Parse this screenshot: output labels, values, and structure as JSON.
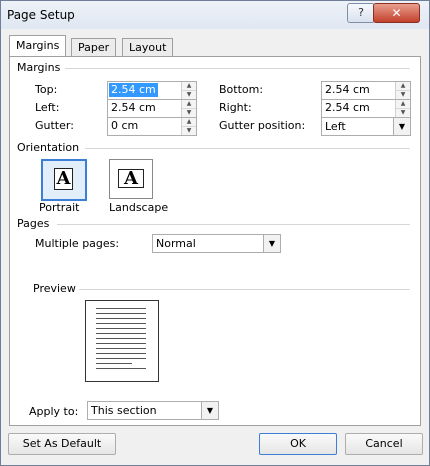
{
  "window": {
    "title": "Page Setup",
    "help_label": "?",
    "close_label": "✕"
  },
  "tabs": [
    {
      "label": "Margins"
    },
    {
      "label": "Paper"
    },
    {
      "label": "Layout"
    }
  ],
  "margins": {
    "section_label": "Margins",
    "top_label": "Top:",
    "top_value": "2.54 cm",
    "left_label": "Left:",
    "left_value": "2.54 cm",
    "gutter_label": "Gutter:",
    "gutter_value": "0 cm",
    "bottom_label": "Bottom:",
    "bottom_value": "2.54 cm",
    "right_label": "Right:",
    "right_value": "2.54 cm",
    "gutter_position_label": "Gutter position:",
    "gutter_position_value": "Left"
  },
  "orientation": {
    "section_label": "Orientation",
    "icon_letter": "A",
    "portrait_label": "Portrait",
    "landscape_label": "Landscape",
    "selected": "portrait"
  },
  "pages": {
    "section_label": "Pages",
    "multiple_pages_label": "Multiple pages:",
    "multiple_pages_value": "Normal"
  },
  "preview": {
    "section_label": "Preview"
  },
  "apply_to": {
    "label": "Apply to:",
    "value": "This section"
  },
  "buttons": {
    "set_default": "Set As Default",
    "ok": "OK",
    "cancel": "Cancel"
  },
  "colors": {
    "accent": "#3c7fd8",
    "selection": "#3399ff",
    "close": "#c2412c"
  },
  "icons": {
    "spin_up": "▲",
    "spin_down": "▼",
    "dropdown": "▼"
  }
}
